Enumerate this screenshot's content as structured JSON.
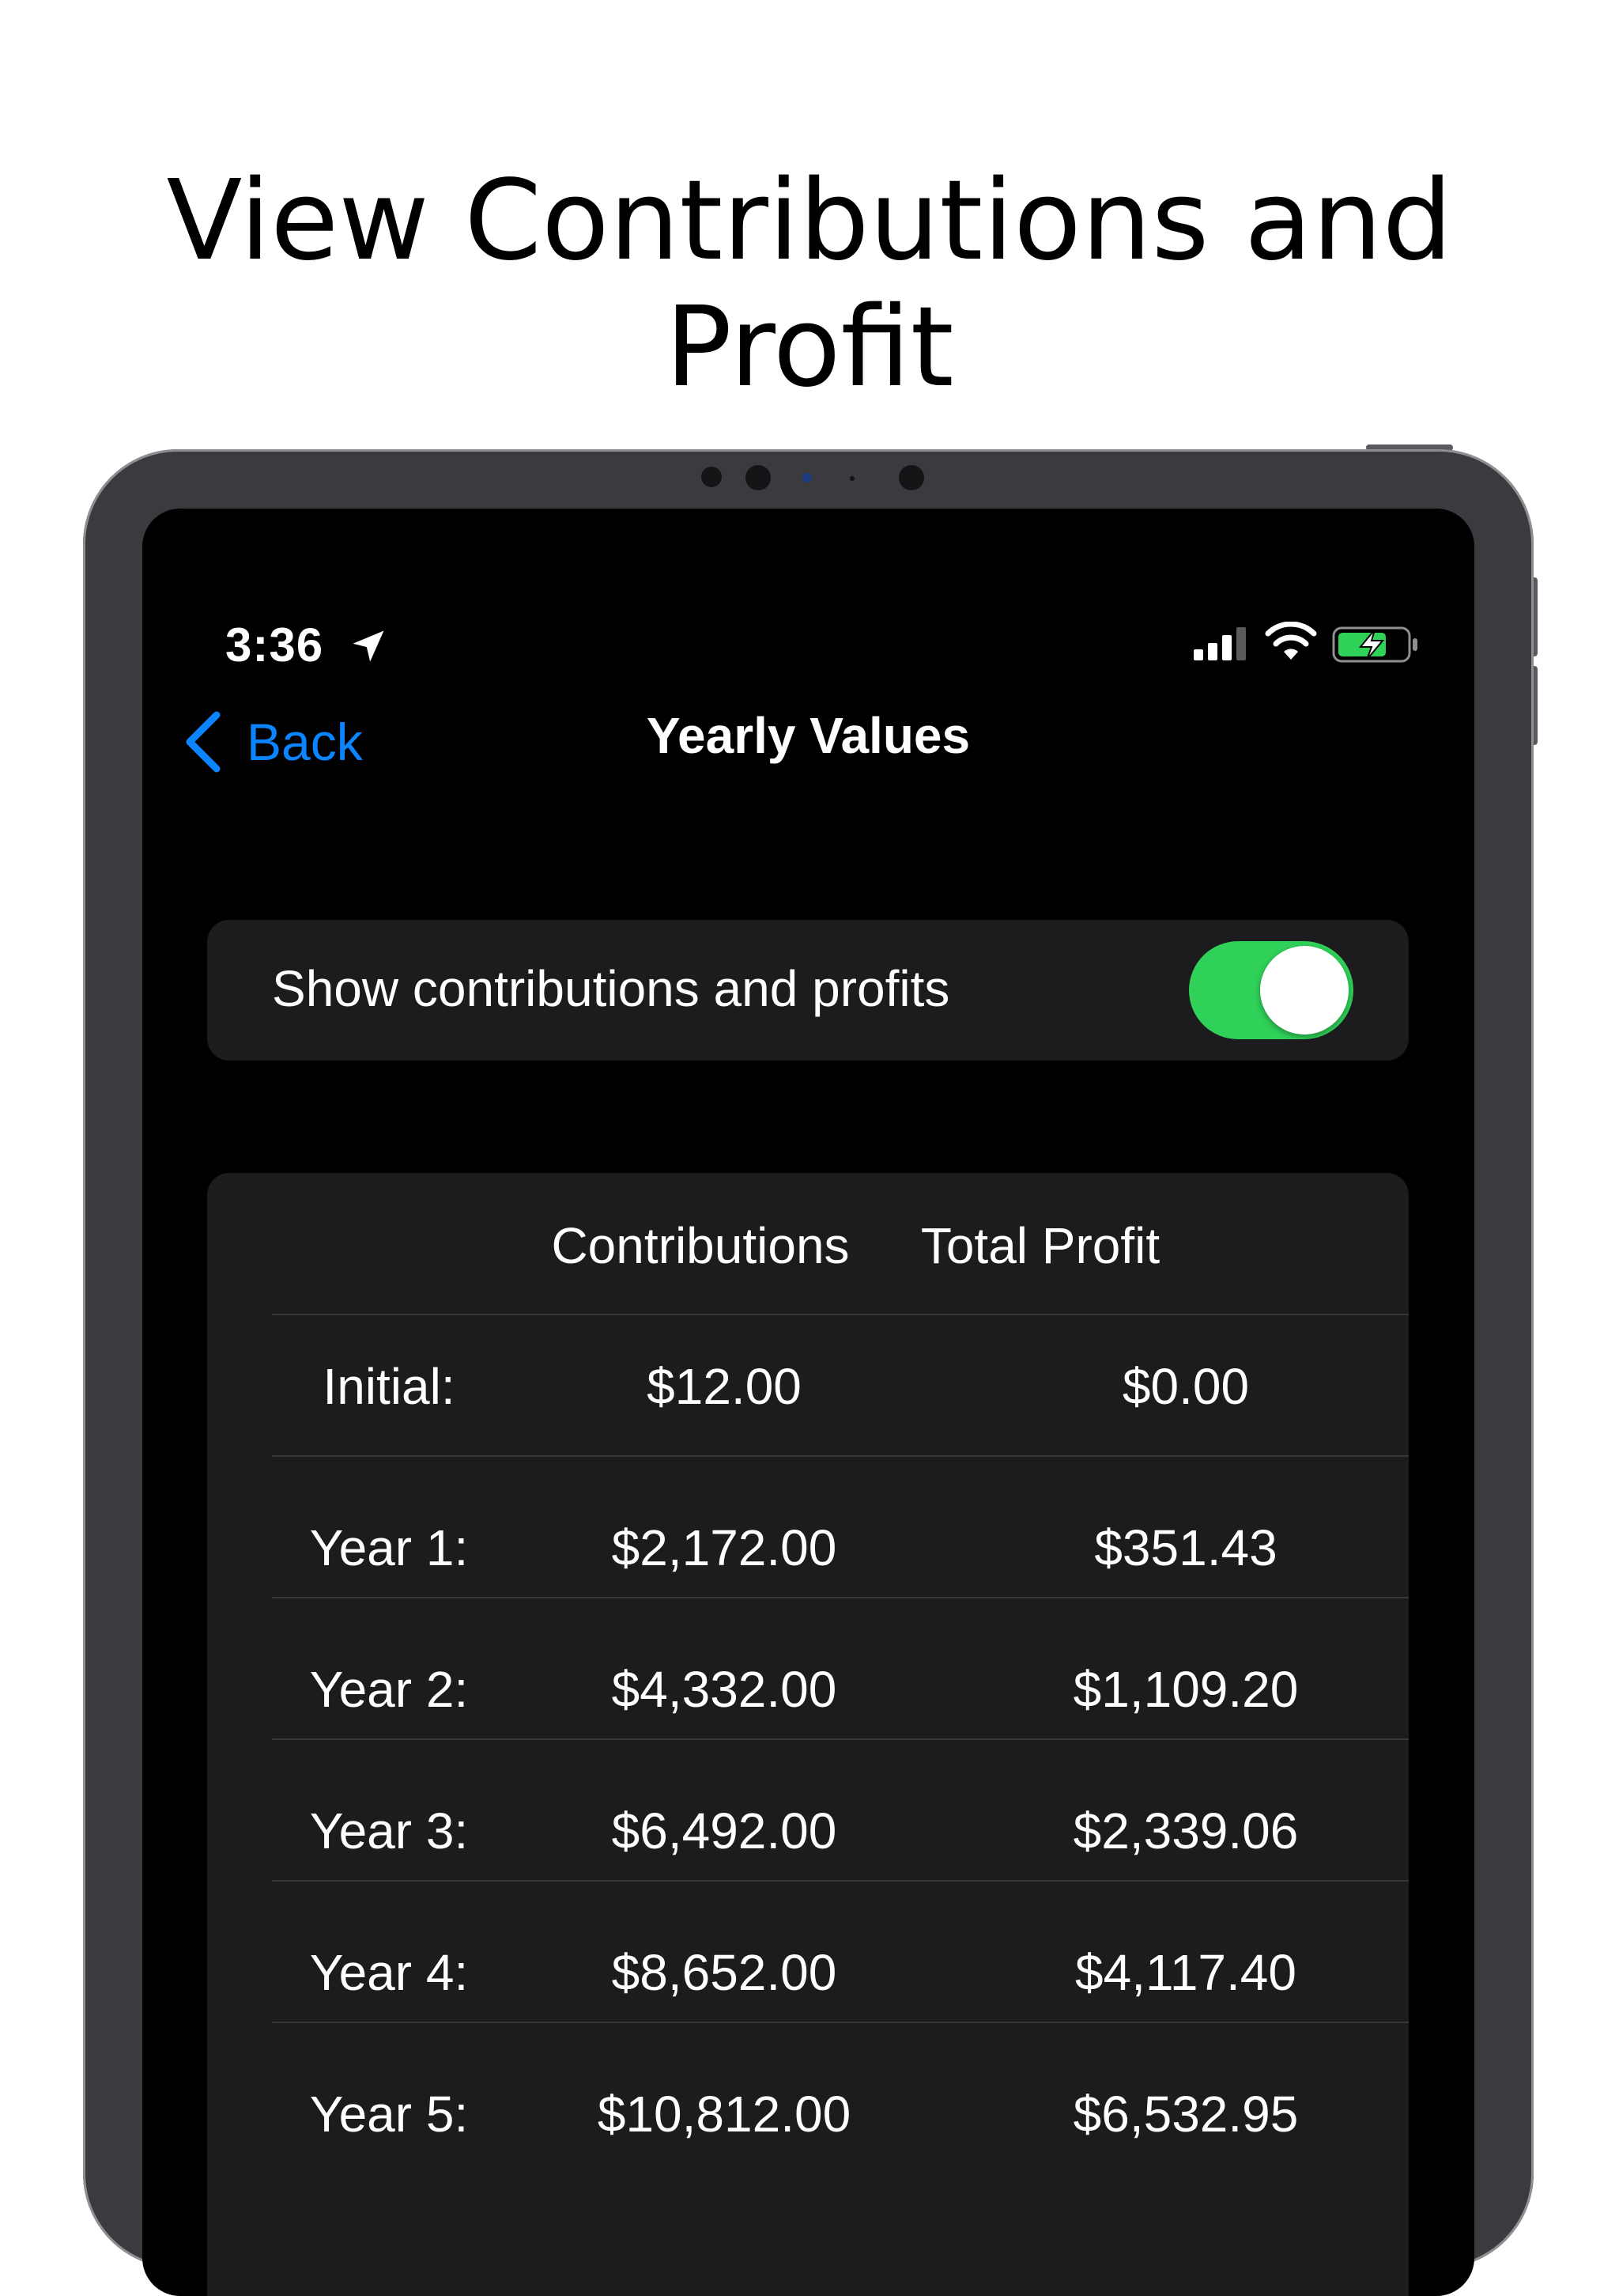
{
  "headline": {
    "line1": "View Contributions and",
    "line2": "Profit"
  },
  "status_bar": {
    "time": "3:36",
    "location_icon": "location-arrow-icon",
    "signal_icon": "cellular-signal-icon",
    "wifi_icon": "wifi-icon",
    "battery_icon": "battery-charging-icon",
    "battery_color": "#30d158"
  },
  "nav": {
    "back_label": "Back",
    "title": "Yearly Values",
    "accent_color": "#0a84ff"
  },
  "toggle": {
    "label": "Show contributions and profits",
    "state": "on",
    "on_color": "#30d158"
  },
  "table": {
    "headers": [
      "",
      "Contributions",
      "Total Profit"
    ],
    "rows": [
      {
        "label": "Initial:",
        "contributions": "$12.00",
        "profit": "$0.00"
      },
      {
        "label": "Year 1:",
        "contributions": "$2,172.00",
        "profit": "$351.43"
      },
      {
        "label": "Year 2:",
        "contributions": "$4,332.00",
        "profit": "$1,109.20"
      },
      {
        "label": "Year 3:",
        "contributions": "$6,492.00",
        "profit": "$2,339.06"
      },
      {
        "label": "Year 4:",
        "contributions": "$8,652.00",
        "profit": "$4,117.40"
      },
      {
        "label": "Year 5:",
        "contributions": "$10,812.00",
        "profit": "$6,532.95"
      }
    ]
  }
}
